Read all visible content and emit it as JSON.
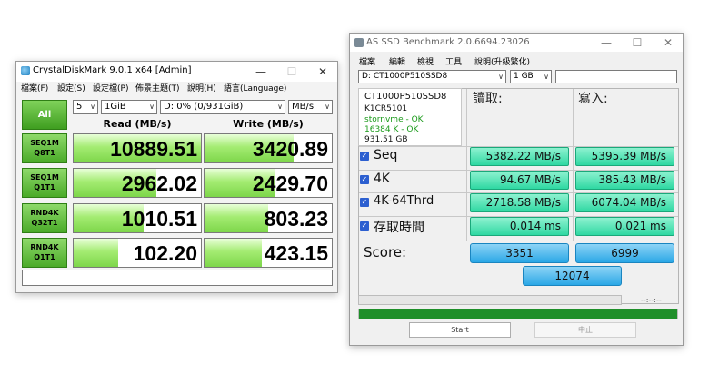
{
  "cdm": {
    "title": "CrystalDiskMark 9.0.1 x64 [Admin]",
    "icon_color": "#2e9bd6",
    "menu": [
      "檔案(F)",
      "設定(S)",
      "設定檔(P)",
      "佈景主題(T)",
      "說明(H)",
      "語言(Language)"
    ],
    "count": "5",
    "size": "1GiB",
    "drive": "D: 0% (0/931GiB)",
    "unit": "MB/s",
    "all_label": "All",
    "read_header": "Read (MB/s)",
    "write_header": "Write (MB/s)",
    "rows": [
      {
        "line1": "SEQ1M",
        "line2": "Q8T1",
        "read": "10889.51",
        "write": "3420.89",
        "read_fill": 1.0,
        "write_fill": 0.7
      },
      {
        "line1": "SEQ1M",
        "line2": "Q1T1",
        "read": "2962.02",
        "write": "2429.70",
        "read_fill": 0.65,
        "write_fill": 0.55
      },
      {
        "line1": "RND4K",
        "line2": "Q32T1",
        "read": "1010.51",
        "write": "803.23",
        "read_fill": 0.55,
        "write_fill": 0.5
      },
      {
        "line1": "RND4K",
        "line2": "Q1T1",
        "read": "102.20",
        "write": "423.15",
        "read_fill": 0.35,
        "write_fill": 0.45
      }
    ]
  },
  "asd": {
    "title": "AS SSD Benchmark 2.0.6694.23026",
    "menu": [
      "檔案",
      "編輯",
      "檢視",
      "工具",
      "說明(升級繁化)"
    ],
    "drive": "D: CT1000P510SSD8",
    "size": "1 GB",
    "info": {
      "model": "CT1000P510SSD8",
      "firmware": "K1CR5101",
      "driver": "stornvme - OK",
      "align": "16384 K - OK",
      "capacity": "931.51 GB"
    },
    "read_header": "讀取:",
    "write_header": "寫入:",
    "rows": [
      {
        "label": "Seq",
        "read": "5382.22 MB/s",
        "write": "5395.39 MB/s"
      },
      {
        "label": "4K",
        "read": "94.67 MB/s",
        "write": "385.43 MB/s"
      },
      {
        "label": "4K-64Thrd",
        "read": "2718.58 MB/s",
        "write": "6074.04 MB/s"
      },
      {
        "label": "存取時間",
        "read": "0.014 ms",
        "write": "0.021 ms"
      }
    ],
    "score_label": "Score:",
    "score_read": "3351",
    "score_write": "6999",
    "score_total": "12074",
    "time": "--:--:--",
    "progress": 1.0,
    "start_label": "Start",
    "abort_label": "中止",
    "colors": {
      "result": "#2fd8a2",
      "score": "#2aa7e6",
      "progress": "#1f8f2a",
      "checkbox": "#2c5fd0"
    }
  }
}
